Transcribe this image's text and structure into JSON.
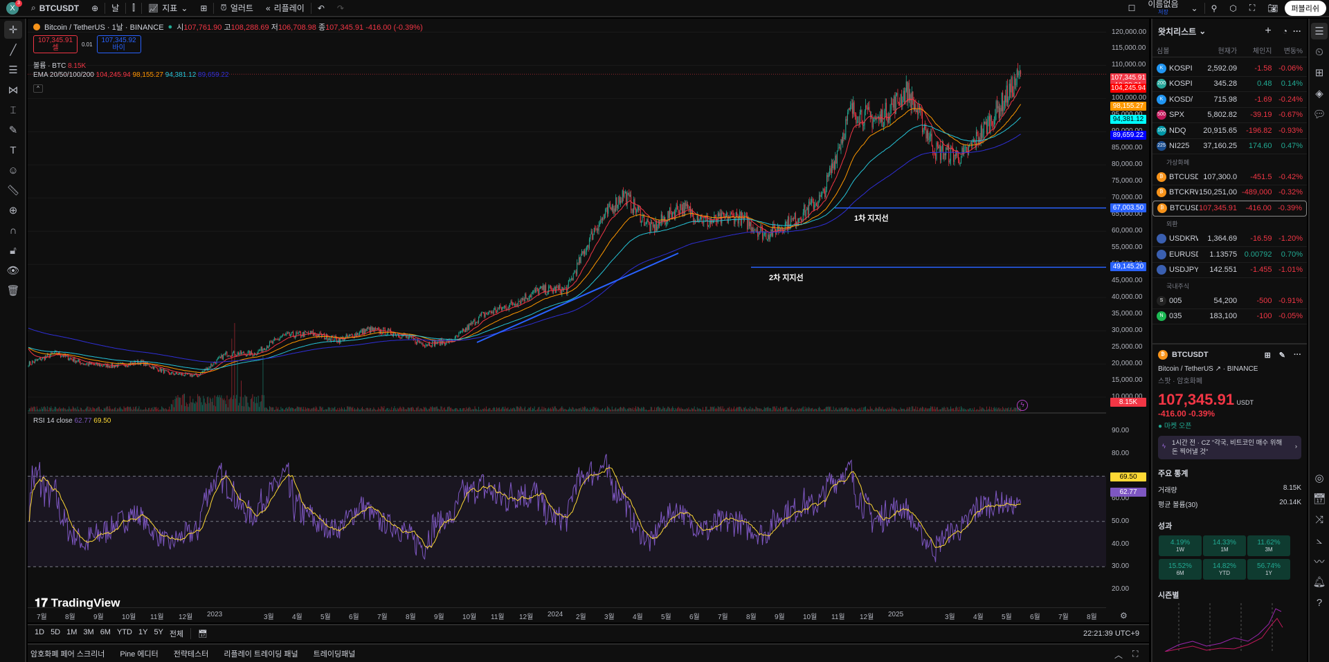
{
  "topbar": {
    "badge": "3",
    "avatar": "X",
    "symbol": "BTCUSDT",
    "interval": "날",
    "indicators": "지표",
    "alert": "얼러트",
    "replay": "리플레이",
    "layout_name": "이름없음",
    "save": "저장",
    "publish": "퍼블리쉬"
  },
  "legend": {
    "title": "Bitcoin / TetherUS · 1날 · BINANCE",
    "o_label": "시",
    "o": "107,761.90",
    "h_label": "고",
    "h": "108,288.69",
    "l_label": "저",
    "l": "106,708.98",
    "c_label": "종",
    "c": "107,345.91",
    "chg": "-416.00 (-0.39%)",
    "sell_price": "107,345.91",
    "sell": "셀",
    "spread": "0.01",
    "buy_price": "107,345.92",
    "buy": "바이",
    "vol_label": "볼륨 · BTC",
    "vol": "8.15K",
    "ema_label": "EMA 20/50/100/200",
    "ema20": "104,245.94",
    "ema50": "98,155.27",
    "ema100": "94,381.12",
    "ema200": "89,659.22"
  },
  "colors": {
    "up": "#22ab94",
    "down": "#f23645",
    "ema20": "#f23645",
    "ema50": "#ff9800",
    "ema100": "#26c6da",
    "ema200": "#2f2fd8",
    "rsi": "#7e57c2",
    "rsi_ma": "#fdd835",
    "line": "#2962ff"
  },
  "axis": {
    "ticks": [
      "120,000.00",
      "115,000.00",
      "110,000.00",
      "105,000.00",
      "100,000.00",
      "95,000.00",
      "90,000.00",
      "85,000.00",
      "80,000.00",
      "75,000.00",
      "70,000.00",
      "65,000.00",
      "60,000.00",
      "55,000.00",
      "50,000.00",
      "45,000.00",
      "40,000.00",
      "35,000.00",
      "30,000.00",
      "25,000.00",
      "20,000.00",
      "15,000.00",
      "10,000.00"
    ],
    "last_price": "107,345.91",
    "countdown": "10:38:21",
    "lbl_ema20": "104,245.94",
    "lbl_ema50": "98,155.27",
    "lbl_ema100": "94,381.12",
    "lbl_ema200": "89,659.22",
    "lbl_line1": "67,003.50",
    "lbl_line2": "49,145.20",
    "lbl_vol": "8.15K",
    "rsi_ticks": [
      "90.00",
      "80.00",
      "70.00",
      "60.00",
      "50.00",
      "40.00",
      "30.00",
      "20.00"
    ],
    "lbl_rsima": "69.50",
    "lbl_rsi": "62.77"
  },
  "drawings": {
    "line1_value": 67003.5,
    "line1_label": "1차 지지선",
    "line2_value": 49145.2,
    "line2_label": "2차 지지선"
  },
  "price_series": {
    "start": 19900,
    "monthly_close": [
      23300,
      20000,
      19400,
      20500,
      17100,
      16500,
      23100,
      23100,
      28400,
      29200,
      27200,
      30400,
      29200,
      26000,
      27000,
      34600,
      37700,
      42200,
      42500,
      61000,
      71300,
      60600,
      67500,
      62700,
      64600,
      58900,
      63300,
      70200,
      96400,
      93400,
      102400,
      84300,
      82500,
      94200,
      107345
    ]
  },
  "rsi": {
    "label": "RSI 14 close",
    "value": "62.77",
    "ma": "69.50"
  },
  "time_axis": [
    "7월",
    "8월",
    "9월",
    "10월",
    "11월",
    "12월",
    "2023",
    "3월",
    "4월",
    "5월",
    "6월",
    "7월",
    "8월",
    "9월",
    "10월",
    "11월",
    "12월",
    "2024",
    "2월",
    "3월",
    "4월",
    "5월",
    "6월",
    "7월",
    "8월",
    "9월",
    "10월",
    "11월",
    "12월",
    "2025",
    "3월",
    "4월",
    "5월",
    "6월",
    "7월",
    "8월"
  ],
  "watermark": "TradingView",
  "ranges": [
    "1D",
    "5D",
    "1M",
    "3M",
    "6M",
    "YTD",
    "1Y",
    "5Y",
    "전체"
  ],
  "clock": "22:21:39 UTC+9",
  "bottom_tabs": [
    "암호화폐 페어 스크리너",
    "Pine 에디터",
    "전략테스터",
    "리플레이 트레이딩 패널",
    "트레이딩패널"
  ],
  "watchlist": {
    "title": "왓치리스트",
    "cols": [
      "심볼",
      "현재가",
      "체인지",
      "변동%"
    ],
    "rows": [
      {
        "sym": "KOSPI",
        "icon": "K",
        "p": "2,592.09",
        "c": "-1.58",
        "pc": "-0.06%",
        "up": false
      },
      {
        "sym": "KOSPI",
        "icon": "200",
        "p": "345.28",
        "c": "0.48",
        "pc": "0.14%",
        "up": true
      },
      {
        "sym": "KOSD/",
        "icon": "K",
        "p": "715.98",
        "c": "-1.69",
        "pc": "-0.24%",
        "up": false
      },
      {
        "sym": "SPX",
        "icon": "500",
        "p": "5,802.82",
        "c": "-39.19",
        "pc": "-0.67%",
        "up": false
      },
      {
        "sym": "NDQ",
        "icon": "100",
        "p": "20,915.65",
        "c": "-196.82",
        "pc": "-0.93%",
        "up": false
      },
      {
        "sym": "NI225",
        "icon": "225",
        "p": "37,160.25",
        "c": "174.60",
        "pc": "0.47%",
        "up": true
      }
    ],
    "group2": "가상화폐",
    "rows2": [
      {
        "sym": "BTCUSD",
        "p": "107,300.0",
        "c": "-451.5",
        "pc": "-0.42%"
      },
      {
        "sym": "BTCKRW",
        "p": "150,251,00",
        "c": "-489,000",
        "pc": "-0.32%"
      },
      {
        "sym": "BTCUSDT",
        "p": "107,345.91",
        "c": "-416.00",
        "pc": "-0.39%"
      }
    ],
    "group3": "외환",
    "rows3": [
      {
        "sym": "USDKRW",
        "p": "1,364.69",
        "c": "-16.59",
        "pc": "-1.20%",
        "up": false
      },
      {
        "sym": "EURUSD",
        "p": "1.13575",
        "c": "0.00792",
        "pc": "0.70%",
        "up": true
      },
      {
        "sym": "USDJPY",
        "p": "142.551",
        "c": "-1.455",
        "pc": "-1.01%",
        "up": false
      }
    ],
    "group4": "국내주식",
    "rows4": [
      {
        "sym": "005",
        "icon": "S",
        "p": "54,200",
        "c": "-500",
        "pc": "-0.91%"
      },
      {
        "sym": "035",
        "icon": "N",
        "p": "183,100",
        "c": "-100",
        "pc": "-0.05%"
      }
    ]
  },
  "details": {
    "symbol": "BTCUSDT",
    "name": "Bitcoin / TetherUS",
    "exchange": "BINANCE",
    "type": "스팟 · 암호화폐",
    "price": "107,345.91",
    "currency": "USDT",
    "change": "-416.00",
    "change_pct": "-0.39%",
    "status": "마켓 오픈",
    "news": "1시간 전 · CZ \"각국, 비트코인 매수 위해 돈 찍어낼 것\"",
    "stats_title": "주요 통계",
    "vol_label": "거래량",
    "vol": "8.15K",
    "avgvol_label": "평균 볼륨(30)",
    "avgvol": "20.14K",
    "perf_title": "성과",
    "perf": [
      {
        "v": "4.19%",
        "l": "1W"
      },
      {
        "v": "14.33%",
        "l": "1M"
      },
      {
        "v": "11.62%",
        "l": "3M"
      },
      {
        "v": "15.52%",
        "l": "6M"
      },
      {
        "v": "14.82%",
        "l": "YTD"
      },
      {
        "v": "56.74%",
        "l": "1Y"
      }
    ],
    "seasonal_title": "시즌별"
  }
}
